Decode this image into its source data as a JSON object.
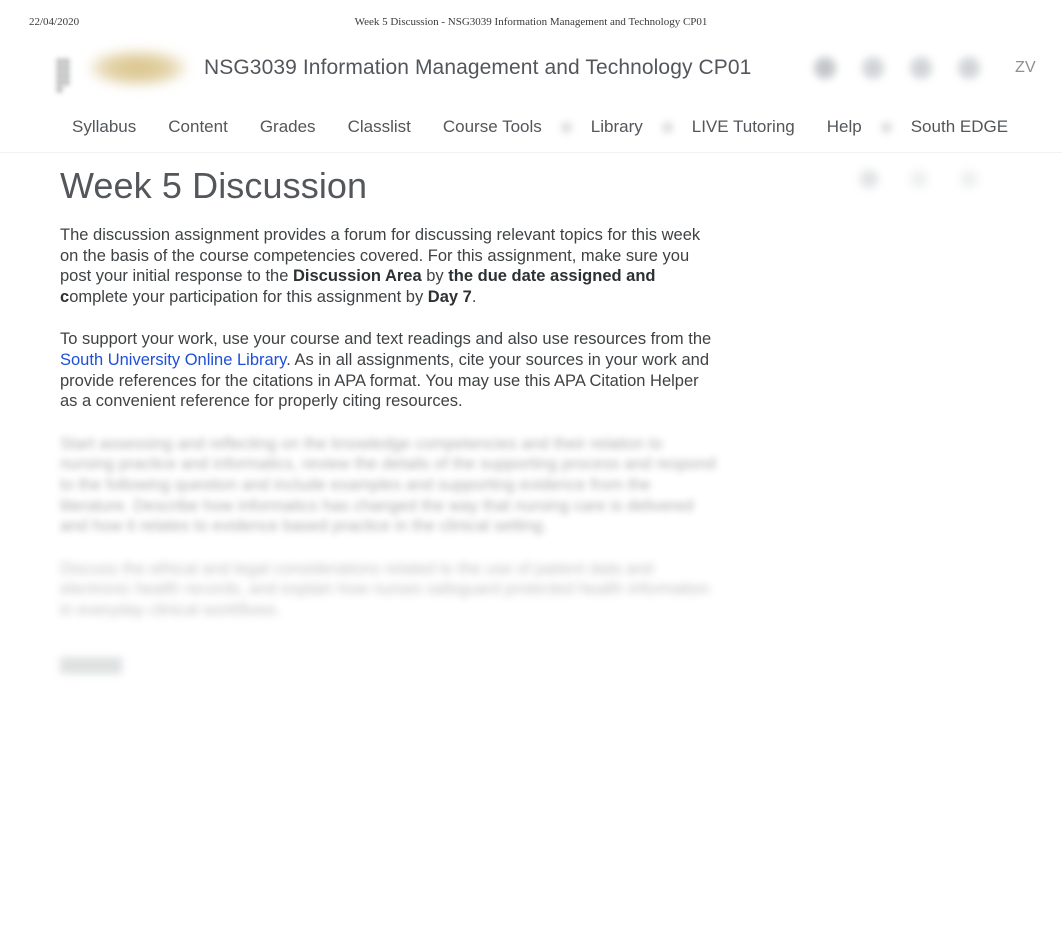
{
  "print_header": {
    "date": "22/04/2020",
    "title": "Week 5 Discussion - NSG3039 Information Management and Technology CP01"
  },
  "brand": {
    "menu_icon": "waffle-grid-icon",
    "logo": "south-university-logo",
    "course_title": "NSG3039 Information Management and Technology CP01",
    "icons": [
      "bell-icon",
      "message-icon",
      "subscription-icon",
      "profile-icon"
    ],
    "user_initials": "ZV"
  },
  "nav": {
    "items": [
      {
        "label": "Syllabus",
        "has_chevron": false
      },
      {
        "label": "Content",
        "has_chevron": false
      },
      {
        "label": "Grades",
        "has_chevron": false
      },
      {
        "label": "Classlist",
        "has_chevron": false
      },
      {
        "label": "Course Tools",
        "has_chevron": true
      },
      {
        "label": "Library",
        "has_chevron": true
      },
      {
        "label": "LIVE Tutoring",
        "has_chevron": false
      },
      {
        "label": "Help",
        "has_chevron": true
      },
      {
        "label": "South EDGE",
        "has_chevron": false
      }
    ]
  },
  "page": {
    "title": "Week 5 Discussion",
    "actions": [
      "print-icon",
      "settings-icon",
      "more-options-icon"
    ]
  },
  "content": {
    "paragraph1": {
      "part1": "The discussion assignment provides a forum for discussing relevant topics for this week on the basis of the course competencies covered. For this assignment, make sure you post your initial response to the ",
      "bold1": "Discussion Area",
      "part2": " by ",
      "bold2": "the due date assigned and c",
      "part3": "omplete your participation for this assignment by ",
      "bold3": "Day 7",
      "part4": "."
    },
    "paragraph2": {
      "part1": "To support your work, use your course and text readings and also use resources from the ",
      "link": "South University Online Library",
      "part2": ". As in all assignments, cite your sources in your work and provide references for the citations in APA format. You may use this APA Citation Helper as a convenient reference for properly citing resources."
    },
    "paragraph3_blurred": "Start assessing and reflecting on the knowledge competencies and their relation to nursing practice and informatics, review the details of the supporting process and respond to the following question and include examples and supporting evidence from the literature. Describe how informatics has changed the way that nursing care is delivered and how it relates to evidence based practice in the clinical setting.",
    "paragraph4_blurred": "Discuss the ethical and legal considerations related to the use of patient data and electronic health records, and explain how nurses safeguard protected health information in everyday clinical workflows.",
    "footer_blurred": "Reply"
  }
}
